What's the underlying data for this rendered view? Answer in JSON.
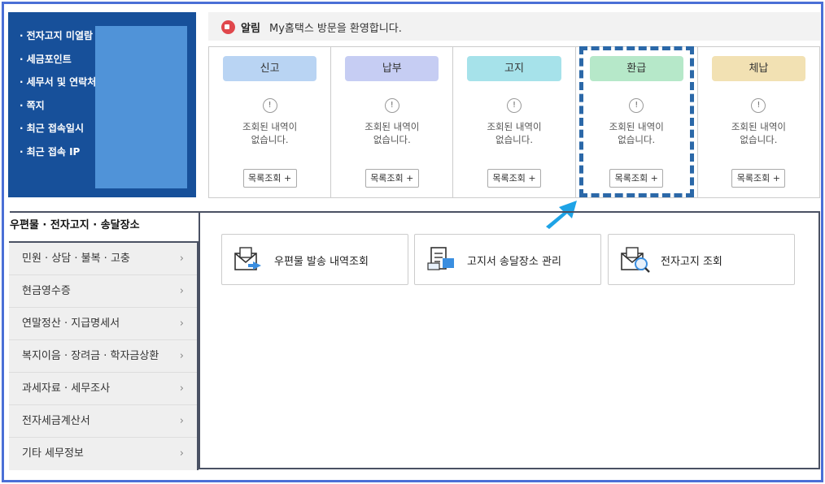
{
  "user_panel": {
    "items": [
      "전자고지 미열람",
      "세금포인트",
      "세무서 및 연락처",
      "쪽지",
      "최근 접속일시",
      "최근 접속 IP"
    ]
  },
  "notice": {
    "label": "알림",
    "message": "My홈택스 방문을 환영합니다."
  },
  "status_cards": [
    {
      "title": "신고",
      "color": "#b9d4f3",
      "empty_line1": "조회된 내역이",
      "empty_line2": "없습니다.",
      "button": "목록조회 +"
    },
    {
      "title": "납부",
      "color": "#c6cdf3",
      "empty_line1": "조회된 내역이",
      "empty_line2": "없습니다.",
      "button": "목록조회 +"
    },
    {
      "title": "고지",
      "color": "#a6e2ea",
      "empty_line1": "조회된 내역이",
      "empty_line2": "없습니다.",
      "button": "목록조회 +"
    },
    {
      "title": "환급",
      "color": "#b6e8c9",
      "empty_line1": "조회된 내역이",
      "empty_line2": "없습니다.",
      "button": "목록조회 +"
    },
    {
      "title": "체납",
      "color": "#f2e1b3",
      "empty_line1": "조회된 내역이",
      "empty_line2": "없습니다.",
      "button": "목록조회 +"
    }
  ],
  "warn_glyph": "!",
  "active_tab": "우편물 · 전자고지 · 송달장소",
  "side_nav": [
    "민원 · 상담 · 불복 · 고충",
    "현금영수증",
    "연말정산 · 지급명세서",
    "복지이음 · 장려금 · 학자금상환",
    "과세자료 · 세무조사",
    "전자세금계산서",
    "기타 세무정보"
  ],
  "chevron": "›",
  "services": [
    {
      "label": "우편물 발송 내역조회",
      "icon": "mail-send-icon"
    },
    {
      "label": "고지서 송달장소 관리",
      "icon": "document-location-icon"
    },
    {
      "label": "전자고지 조회",
      "icon": "mail-search-icon"
    }
  ],
  "colors": {
    "accent_blue": "#17509a",
    "highlight": "#2b68a8",
    "arrow": "#1ea3e6"
  }
}
